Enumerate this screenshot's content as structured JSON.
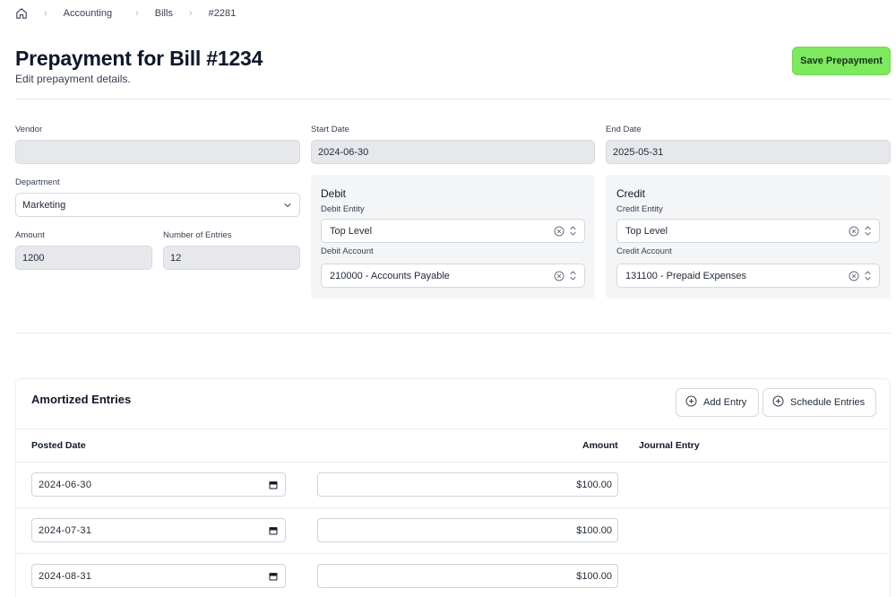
{
  "breadcrumb": {
    "items": [
      "Accounting",
      "Bills",
      "#2281"
    ]
  },
  "header": {
    "title": "Prepayment for Bill #1234",
    "subtitle": "Edit prepayment details.",
    "save_label": "Save Prepayment"
  },
  "form": {
    "vendor": {
      "label": "Vendor",
      "value": ""
    },
    "start_date": {
      "label": "Start Date",
      "value": "2024-06-30"
    },
    "end_date": {
      "label": "End Date",
      "value": "2025-05-31"
    },
    "department": {
      "label": "Department",
      "value": "Marketing"
    },
    "amount": {
      "label": "Amount",
      "value": "1200"
    },
    "entries": {
      "label": "Number of Entries",
      "value": "12"
    }
  },
  "debit": {
    "title": "Debit",
    "entity_label": "Debit Entity",
    "entity_value": "Top Level",
    "account_label": "Debit Account",
    "account_value": "210000 - Accounts Payable"
  },
  "credit": {
    "title": "Credit",
    "entity_label": "Credit Entity",
    "entity_value": "Top Level",
    "account_label": "Credit Account",
    "account_value": "131100 - Prepaid Expenses"
  },
  "amortized": {
    "title": "Amortized Entries",
    "add_label": "Add Entry",
    "schedule_label": "Schedule Entries",
    "columns": {
      "posted_date": "Posted Date",
      "amount": "Amount",
      "journal_entry": "Journal Entry"
    },
    "rows": [
      {
        "date": "2024-06-30",
        "amount": "$100.00"
      },
      {
        "date": "2024-07-31",
        "amount": "$100.00"
      },
      {
        "date": "2024-08-31",
        "amount": "$100.00"
      }
    ]
  },
  "colors": {
    "accent": "#7ee85f",
    "readonly_bg": "#e7e8ec",
    "panel_bg": "#f4f5f7"
  },
  "icons": [
    "home-icon",
    "chevron-right-icon",
    "chevron-down-icon",
    "clear-circle-icon",
    "updown-chevron-icon",
    "plus-circle-icon",
    "calendar-icon"
  ]
}
